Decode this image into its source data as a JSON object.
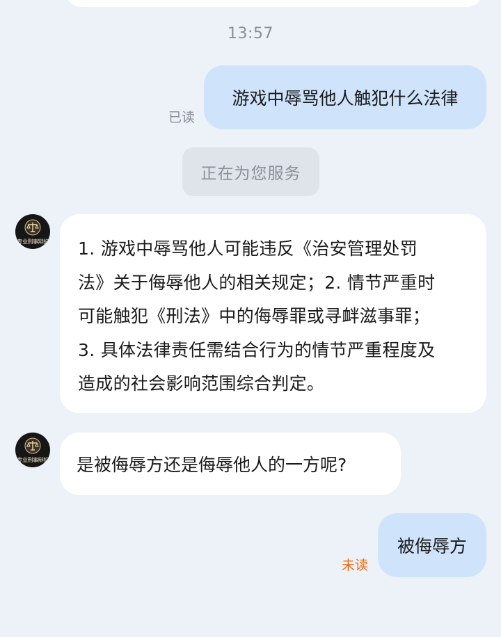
{
  "chat": {
    "timestamp": "13:57",
    "messages": [
      {
        "sender": "user",
        "text": "游戏中辱骂他人触犯什么法律",
        "status": "已读"
      },
      {
        "sender": "system",
        "text": "正在为您服务"
      },
      {
        "sender": "bot",
        "avatar_caption": "专业刑事辩护",
        "lines": [
          "1. 游戏中辱骂他人可能违反《治安管理处罚",
          "法》关于侮辱他人的相关规定；2. 情节严重时",
          "可能触犯《刑法》中的侮辱罪或寻衅滋事罪；",
          "3. 具体法律责任需结合行为的情节严重程度及",
          "造成的社会影响范围综合判定。"
        ]
      },
      {
        "sender": "bot",
        "avatar_caption": "专业刑事辩护",
        "text": "是被侮辱方还是侮辱他人的一方呢?"
      },
      {
        "sender": "user",
        "text": "被侮辱方",
        "status": "未读"
      }
    ]
  },
  "icons": {
    "avatar": "scales-of-justice-icon"
  },
  "colors": {
    "background": "#edf1f8",
    "user_bubble": "#cfe3fb",
    "bot_bubble": "#ffffff",
    "system_pill": "#dfe3ea",
    "unread_status": "#ee6d13",
    "read_status": "#8a8e97"
  }
}
